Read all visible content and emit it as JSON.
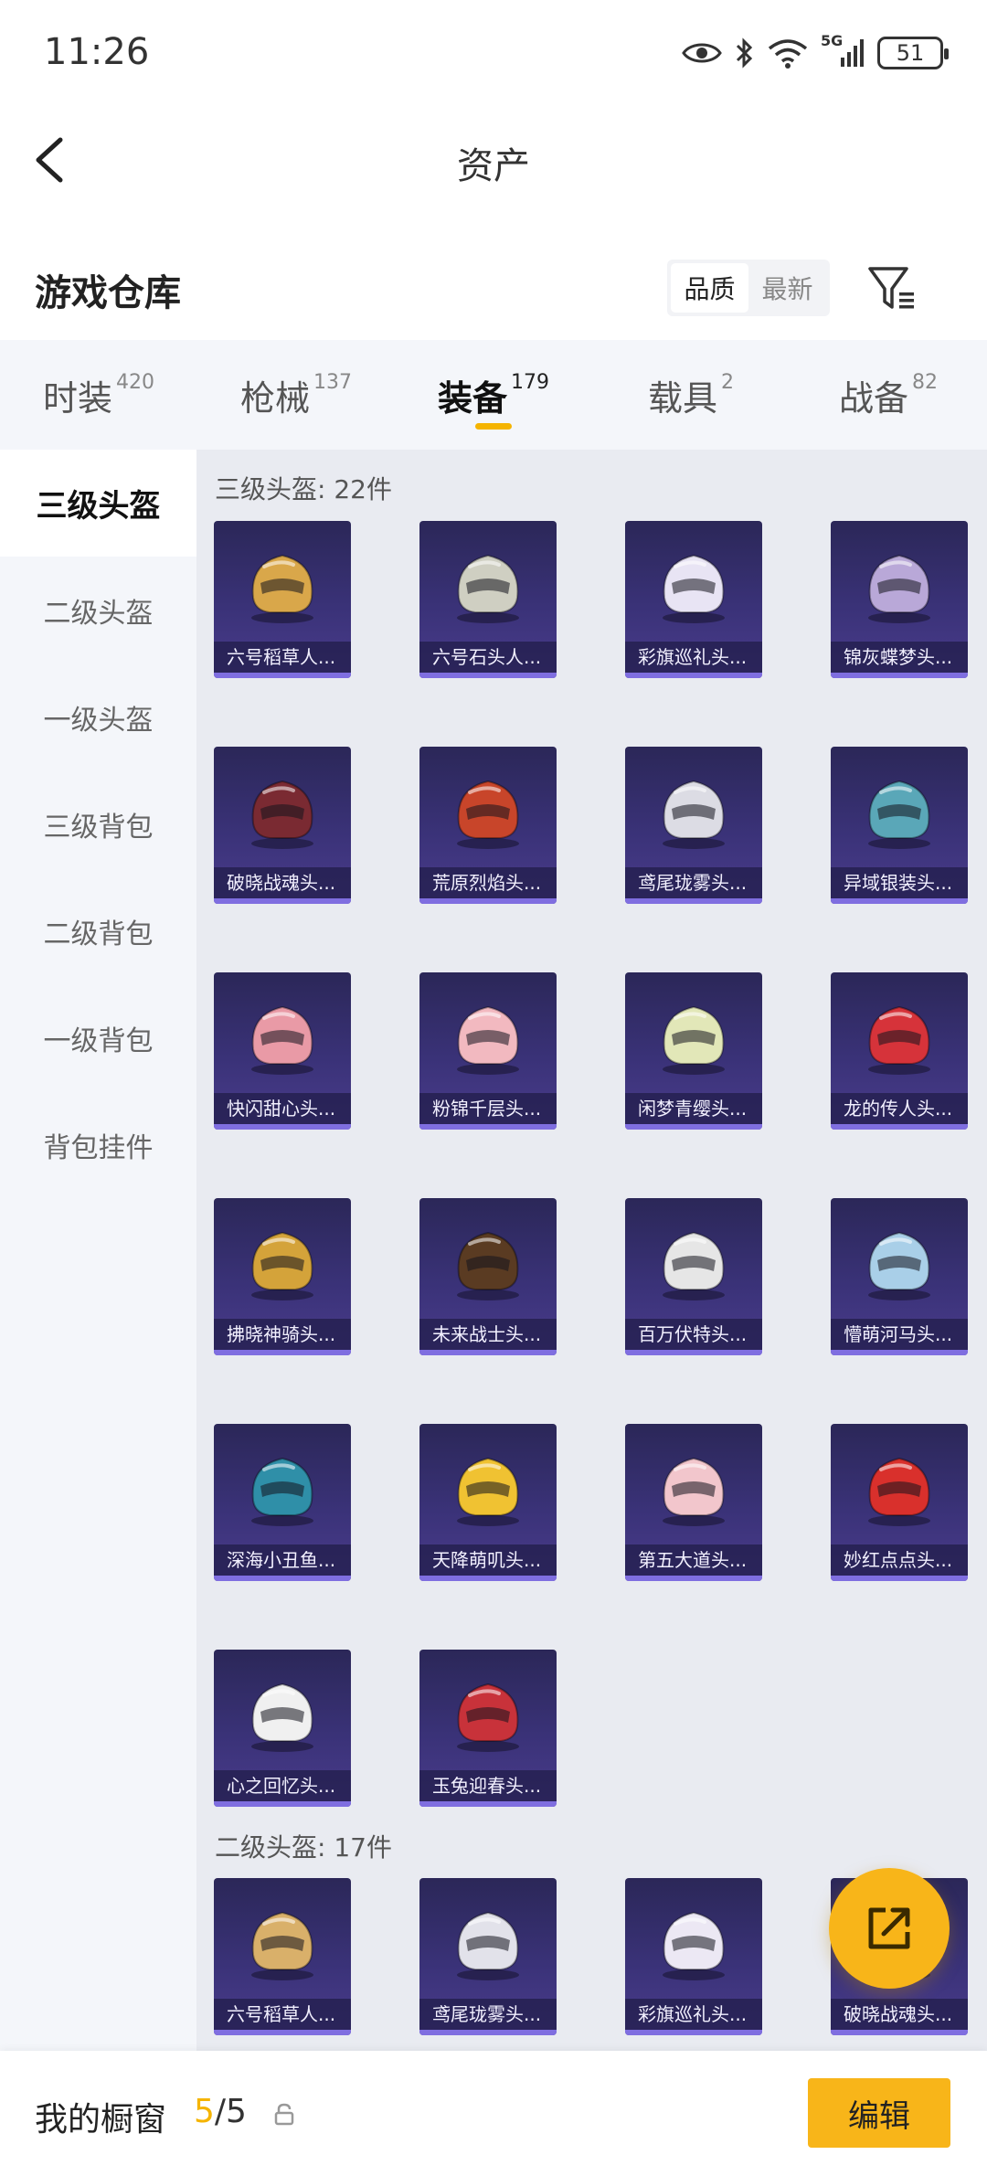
{
  "status_bar": {
    "time": "11:26",
    "battery": "51",
    "network": "5G"
  },
  "header": {
    "title": "资产"
  },
  "warehouse": {
    "title": "游戏仓库",
    "sort_options": [
      "品质",
      "最新"
    ],
    "active_sort": "品质"
  },
  "tabs": [
    {
      "label": "时装",
      "count": "420"
    },
    {
      "label": "枪械",
      "count": "137"
    },
    {
      "label": "装备",
      "count": "179",
      "active": true
    },
    {
      "label": "载具",
      "count": "2"
    },
    {
      "label": "战备",
      "count": "82"
    }
  ],
  "sidebar": {
    "items": [
      {
        "label": "三级头盔",
        "active": true
      },
      {
        "label": "二级头盔"
      },
      {
        "label": "一级头盔"
      },
      {
        "label": "三级背包"
      },
      {
        "label": "二级背包"
      },
      {
        "label": "一级背包"
      },
      {
        "label": "背包挂件"
      }
    ]
  },
  "sections": [
    {
      "title": "三级头盔: 22件",
      "items": [
        {
          "name": "六号稻草人...",
          "color": "#d9a74a"
        },
        {
          "name": "六号石头人...",
          "color": "#cfcfc2"
        },
        {
          "name": "彩旗巡礼头...",
          "color": "#e8e4f4"
        },
        {
          "name": "锦灰蝶梦头...",
          "color": "#b9a8d8"
        },
        {
          "name": "破晓战魂头...",
          "color": "#7a2a32"
        },
        {
          "name": "荒原烈焰头...",
          "color": "#c8452a"
        },
        {
          "name": "鸢尾珑雾头...",
          "color": "#dcdce4"
        },
        {
          "name": "异域银装头...",
          "color": "#5aa7b8"
        },
        {
          "name": "快闪甜心头...",
          "color": "#e99aa6"
        },
        {
          "name": "粉锦千层头...",
          "color": "#f2b9c0"
        },
        {
          "name": "闲梦青缨头...",
          "color": "#e2e7b8"
        },
        {
          "name": "龙的传人头...",
          "color": "#d6333a"
        },
        {
          "name": "拂晓神骑头...",
          "color": "#d4a33a"
        },
        {
          "name": "未来战士头...",
          "color": "#5a3b22"
        },
        {
          "name": "百万伏特头...",
          "color": "#e6e6e6"
        },
        {
          "name": "懵萌河马头...",
          "color": "#a9cfe8"
        },
        {
          "name": "深海小丑鱼...",
          "color": "#2f8fa8"
        },
        {
          "name": "天降萌叽头...",
          "color": "#f0c232"
        },
        {
          "name": "第五大道头...",
          "color": "#f2c6cc"
        },
        {
          "name": "妙红点点头...",
          "color": "#d9302c"
        },
        {
          "name": "心之回忆头...",
          "color": "#f0f0f0"
        },
        {
          "name": "玉兔迎春头...",
          "color": "#c8323a"
        }
      ]
    },
    {
      "title": "二级头盔: 17件",
      "items": [
        {
          "name": "六号稻草人...",
          "color": "#d9b06a"
        },
        {
          "name": "鸢尾珑雾头...",
          "color": "#e2e2ea"
        },
        {
          "name": "彩旗巡礼头...",
          "color": "#ece8f4"
        },
        {
          "name": "破晓战魂头...",
          "color": "#7a2a32"
        }
      ]
    }
  ],
  "bottom_bar": {
    "showcase_label": "我的橱窗",
    "showcase_current": "5",
    "showcase_total": "/5",
    "edit_label": "编辑"
  }
}
